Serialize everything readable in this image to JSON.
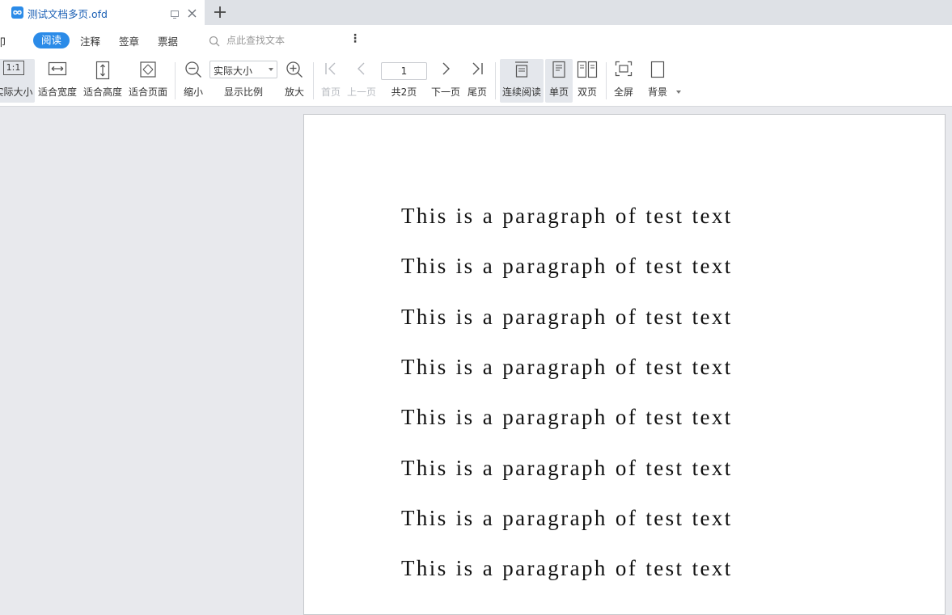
{
  "tab": {
    "title": "测试文档多页.ofd",
    "icon": "ofd-file-icon",
    "accent": "#2b8be8"
  },
  "menu": {
    "cut_item": "印",
    "items": [
      "阅读",
      "注释",
      "签章",
      "票据"
    ],
    "active": "阅读",
    "search_placeholder": "点此查找文本",
    "more_icon": "⋮"
  },
  "toolbar": {
    "fit_actual": "实际大小",
    "fit_actual_icon_text": "1:1",
    "fit_width": "适合宽度",
    "fit_height": "适合高度",
    "fit_page": "适合页面",
    "zoom_out": "缩小",
    "zoom_value": "实际大小",
    "zoom_label": "显示比例",
    "zoom_in": "放大",
    "first_page": "首页",
    "prev_page": "上一页",
    "page_number": "1",
    "page_total": "共2页",
    "next_page": "下一页",
    "last_page": "尾页",
    "continuous": "连续阅读",
    "single": "单页",
    "double": "双页",
    "fullscreen": "全屏",
    "background": "背景"
  },
  "document": {
    "paragraphs": [
      "This is a paragraph of test text",
      "This is a paragraph of test text",
      "This is a paragraph of test text",
      "This is a paragraph of test text",
      "This is a paragraph of test text",
      "This is a paragraph of test text",
      "This is a paragraph of test text",
      "This is a paragraph of test text"
    ]
  }
}
